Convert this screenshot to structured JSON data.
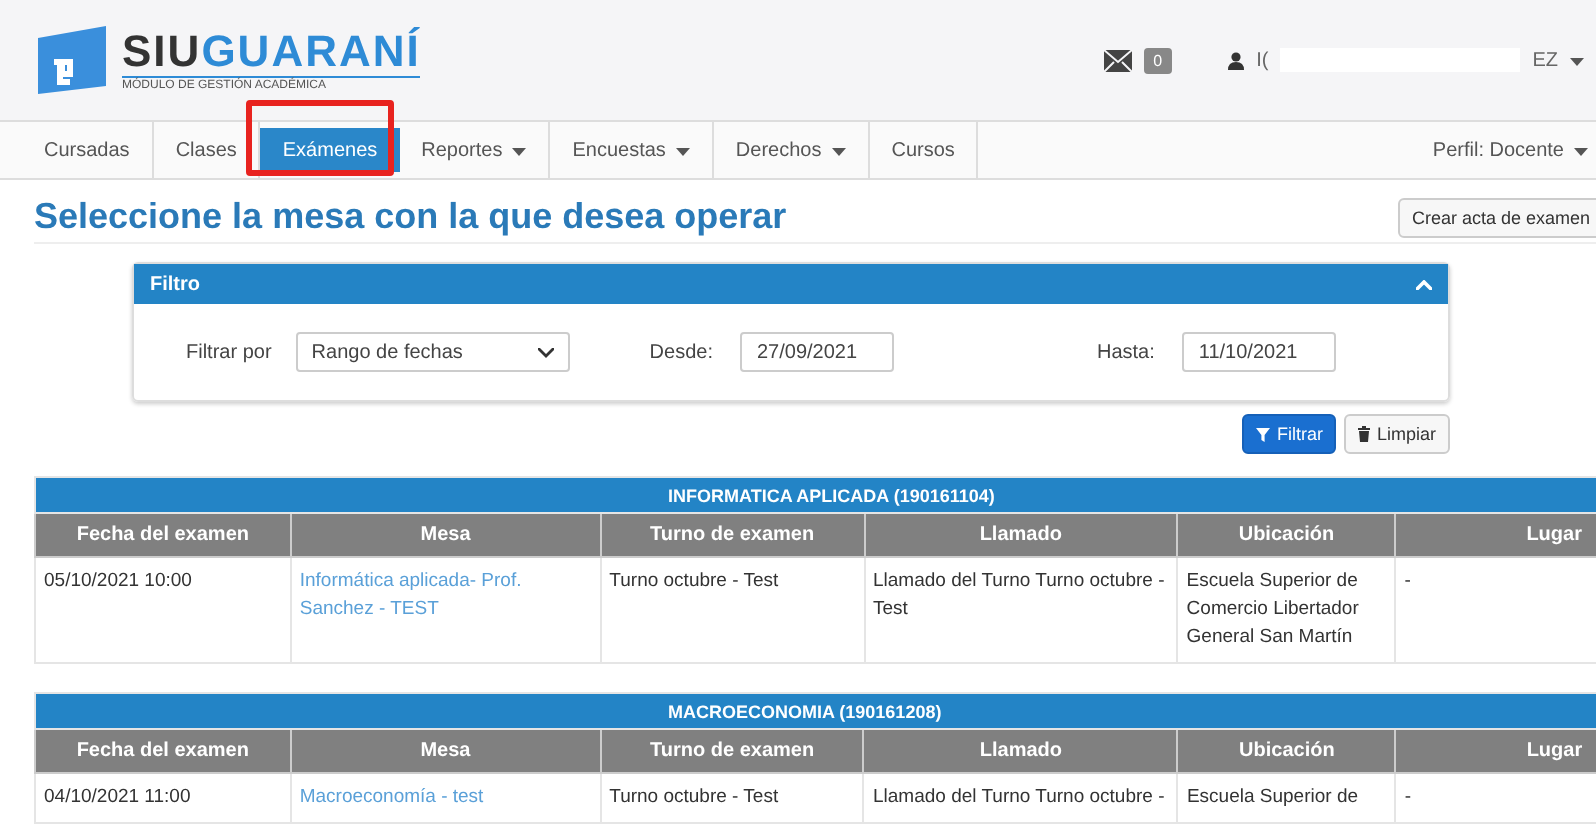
{
  "header": {
    "brand_dark": "SIU",
    "brand_light": "GUARANÍ",
    "subtitle": "MÓDULO DE GESTIÓN ACADÉMICA",
    "messages_count": "0",
    "user_name_start": "I(",
    "user_name_end": "EZ"
  },
  "nav": {
    "tabs": [
      {
        "label": "Cursadas",
        "selected": false,
        "dropdown": false,
        "annotated": false
      },
      {
        "label": "Clases",
        "selected": false,
        "dropdown": false,
        "annotated": false
      },
      {
        "label": "Exámenes",
        "selected": true,
        "dropdown": false,
        "annotated": true
      },
      {
        "label": "Reportes",
        "selected": false,
        "dropdown": true,
        "annotated": false
      },
      {
        "label": "Encuestas",
        "selected": false,
        "dropdown": true,
        "annotated": false
      },
      {
        "label": "Derechos",
        "selected": false,
        "dropdown": true,
        "annotated": false
      },
      {
        "label": "Cursos",
        "selected": false,
        "dropdown": false,
        "annotated": false
      }
    ],
    "profile": "Perfil: Docente"
  },
  "page_title": "Seleccione la mesa con la que desea operar",
  "create_button": "Crear acta de examen",
  "filter": {
    "title": "Filtro",
    "expanded": true,
    "filter_by_label": "Filtrar por",
    "filter_by_value": "Rango de fechas",
    "from_label": "Desde:",
    "from_value": "27/09/2021",
    "to_label": "Hasta:",
    "to_value": "11/10/2021",
    "filter_button": "Filtrar",
    "clear_button": "Limpiar"
  },
  "tables": [
    {
      "title": "INFORMATICA APLICADA (190161104)",
      "columns": [
        "Fecha del examen",
        "Mesa",
        "Turno de examen",
        "Llamado",
        "Ubicación",
        "Lugar"
      ],
      "rows": [
        [
          "05/10/2021 10:00",
          "Informática aplicada- Prof. Sanchez - TEST",
          "Turno octubre - Test",
          "Llamado del Turno Turno octubre - Test",
          "Escuela Superior de Comercio Libertador General San Martín",
          "-"
        ]
      ]
    },
    {
      "title": "MACROECONOMIA (190161208)",
      "columns": [
        "Fecha del examen",
        "Mesa",
        "Turno de examen",
        "Llamado",
        "Ubicación",
        "Lugar"
      ],
      "rows": [
        [
          "04/10/2021 11:00",
          "Macroeconomía - test",
          "Turno octubre - Test",
          "Llamado del Turno Turno octubre -",
          "Escuela Superior de",
          "-"
        ]
      ]
    }
  ]
}
